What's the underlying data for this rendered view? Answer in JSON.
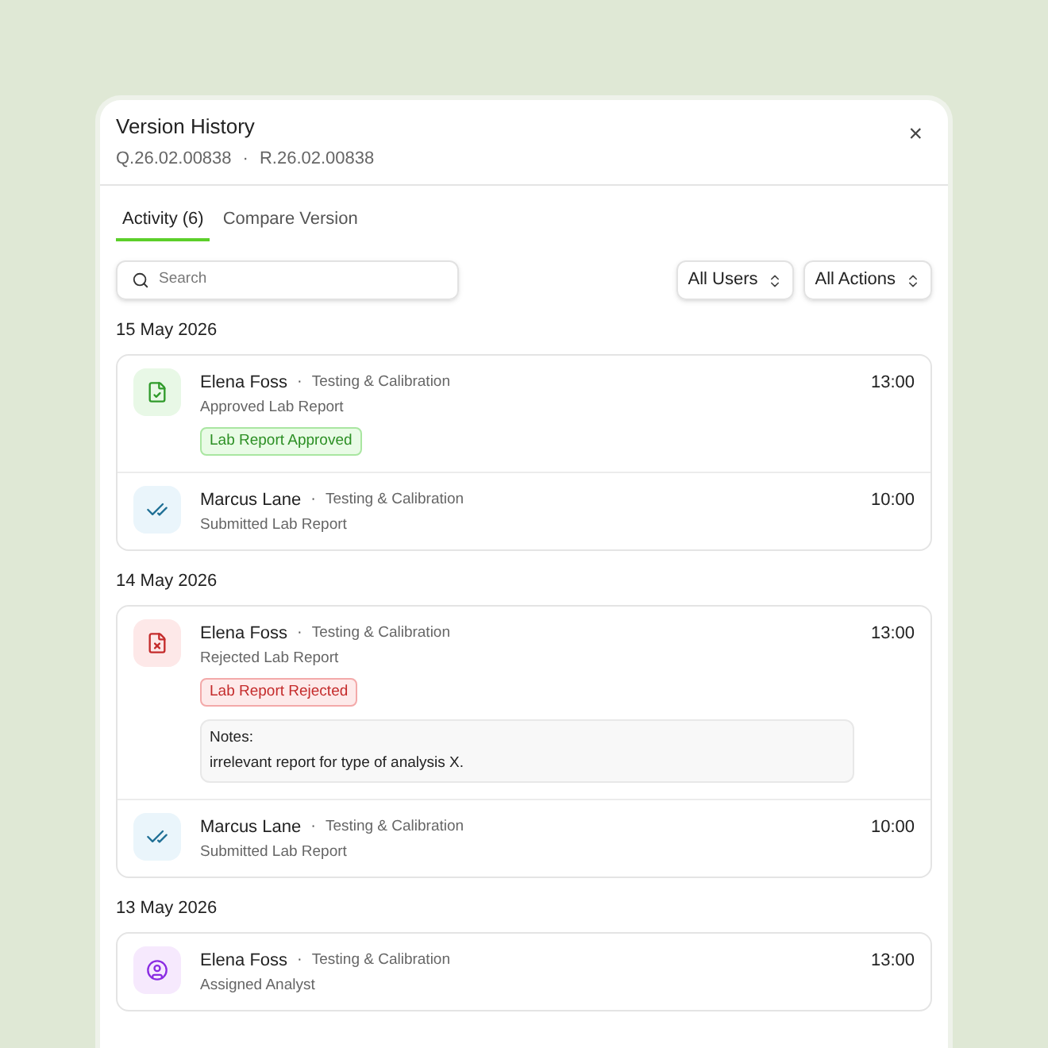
{
  "dialog": {
    "title": "Version History",
    "refs": [
      "Q.26.02.00838",
      "R.26.02.00838"
    ],
    "separator": "·",
    "close": "×"
  },
  "tabs": [
    {
      "label": "Activity (6)",
      "selected": true
    },
    {
      "label": "Compare Version",
      "selected": false
    }
  ],
  "search": {
    "placeholder": "Search"
  },
  "filters": [
    "All Users",
    "All Actions"
  ],
  "groups": [
    {
      "date": "15 May 2026",
      "entries": [
        {
          "kind": "approved",
          "user": "Elena Foss",
          "team": "Testing & Calibration",
          "action": "Approved Lab Report",
          "time": "13:00",
          "badge": "Lab Report Approved"
        },
        {
          "kind": "submitted",
          "user": "Marcus Lane",
          "team": "Testing & Calibration",
          "action": "Submitted Lab Report",
          "time": "10:00"
        }
      ]
    },
    {
      "date": "14 May 2026",
      "entries": [
        {
          "kind": "rejected",
          "user": "Elena Foss",
          "team": "Testing & Calibration",
          "action": "Rejected Lab Report",
          "time": "13:00",
          "badge": "Lab Report Rejected",
          "notes_label": "Notes:",
          "notes": "irrelevant report for type of analysis X."
        },
        {
          "kind": "submitted",
          "user": "Marcus Lane",
          "team": "Testing & Calibration",
          "action": "Submitted Lab Report",
          "time": "10:00"
        }
      ]
    },
    {
      "date": "13 May 2026",
      "entries": [
        {
          "kind": "assigned",
          "user": "Elena Foss",
          "team": "Testing & Calibration",
          "action": "Assigned Analyst",
          "time": "13:00"
        }
      ]
    }
  ]
}
